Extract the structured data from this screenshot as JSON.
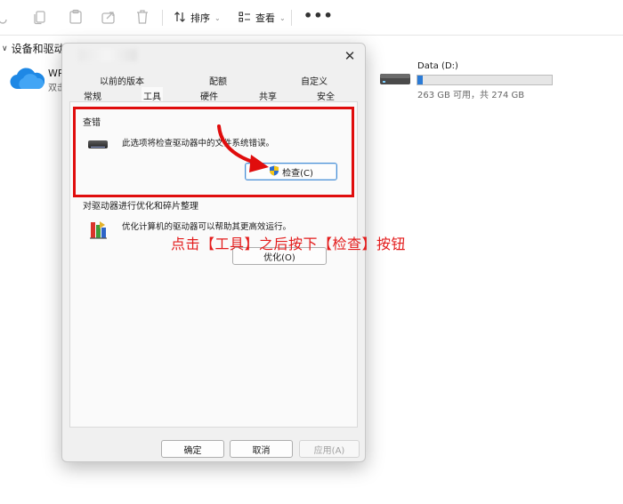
{
  "toolbar": {
    "sort_label": "排序",
    "view_label": "查看",
    "more_label": "•••"
  },
  "explorer": {
    "section_title": "设备和驱动器",
    "cloud_item": {
      "name": "WP",
      "sub": "双击"
    },
    "drive": {
      "name": "Data (D:)",
      "space": "263 GB 可用，共 274 GB",
      "used_fraction": 0.04
    }
  },
  "dialog": {
    "tabs_row1": [
      "以前的版本",
      "配额",
      "自定义"
    ],
    "tabs_row2": [
      "常规",
      "工具",
      "硬件",
      "共享",
      "安全"
    ],
    "active_tab": "工具",
    "error_check": {
      "title": "查错",
      "desc": "此选项将检查驱动器中的文件系统错误。",
      "button": "检查(C)"
    },
    "optimize": {
      "title": "对驱动器进行优化和碎片整理",
      "desc": "优化计算机的驱动器可以帮助其更高效运行。",
      "button": "优化(O)"
    },
    "footer": {
      "ok": "确定",
      "cancel": "取消",
      "apply": "应用(A)"
    }
  },
  "annotation": {
    "text": "点击【工具】之后按下【检查】按钮",
    "color": "#e31b1b"
  }
}
